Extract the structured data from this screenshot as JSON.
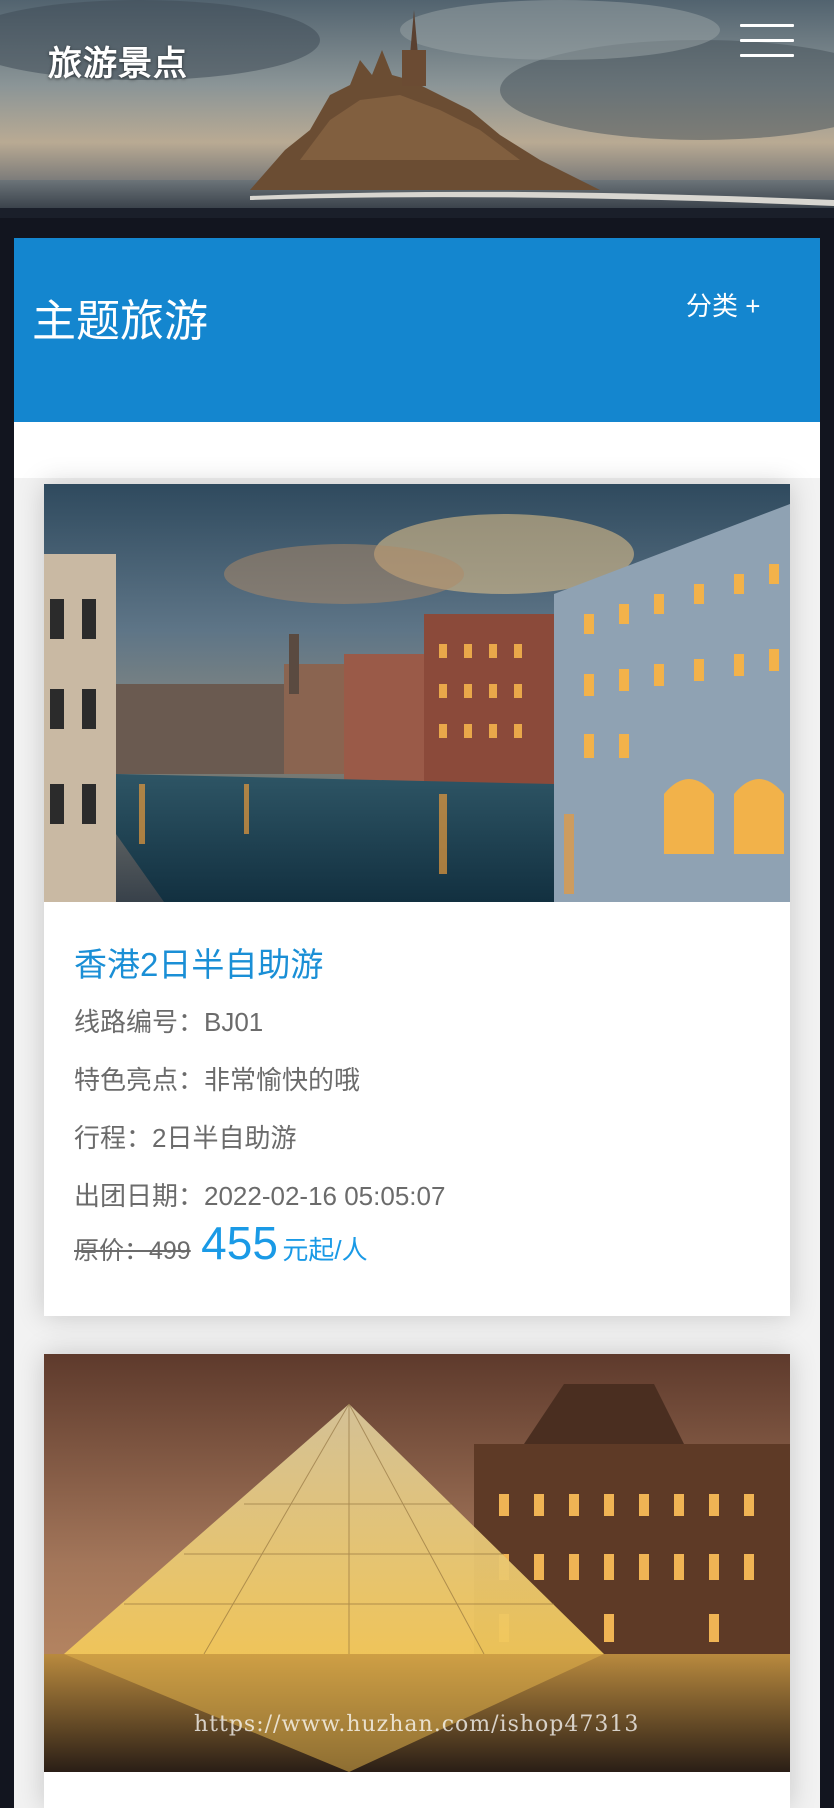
{
  "header": {
    "logo_text": "旅游景点",
    "menu_icon": "hamburger-menu-icon"
  },
  "section": {
    "title": "主题旅游",
    "category_toggle": "分类 +"
  },
  "tours": [
    {
      "image": "venice-grand-canal-dusk",
      "title": "香港2日半自助游",
      "route_code": "线路编号：BJ01",
      "highlight": "特色亮点：非常愉快的哦",
      "itinerary": "行程：2日半自助游",
      "departure": "出团日期：2022-02-16 05:05:07",
      "original_price": "原价：499",
      "price": "455",
      "price_unit": "元起/人"
    },
    {
      "image": "louvre-pyramid-night",
      "watermark": "https://www.huzhan.com/ishop47313"
    }
  ],
  "colors": {
    "brand_blue": "#1486cf",
    "price_blue": "#1a9ae6",
    "page_bg": "#12151f"
  }
}
